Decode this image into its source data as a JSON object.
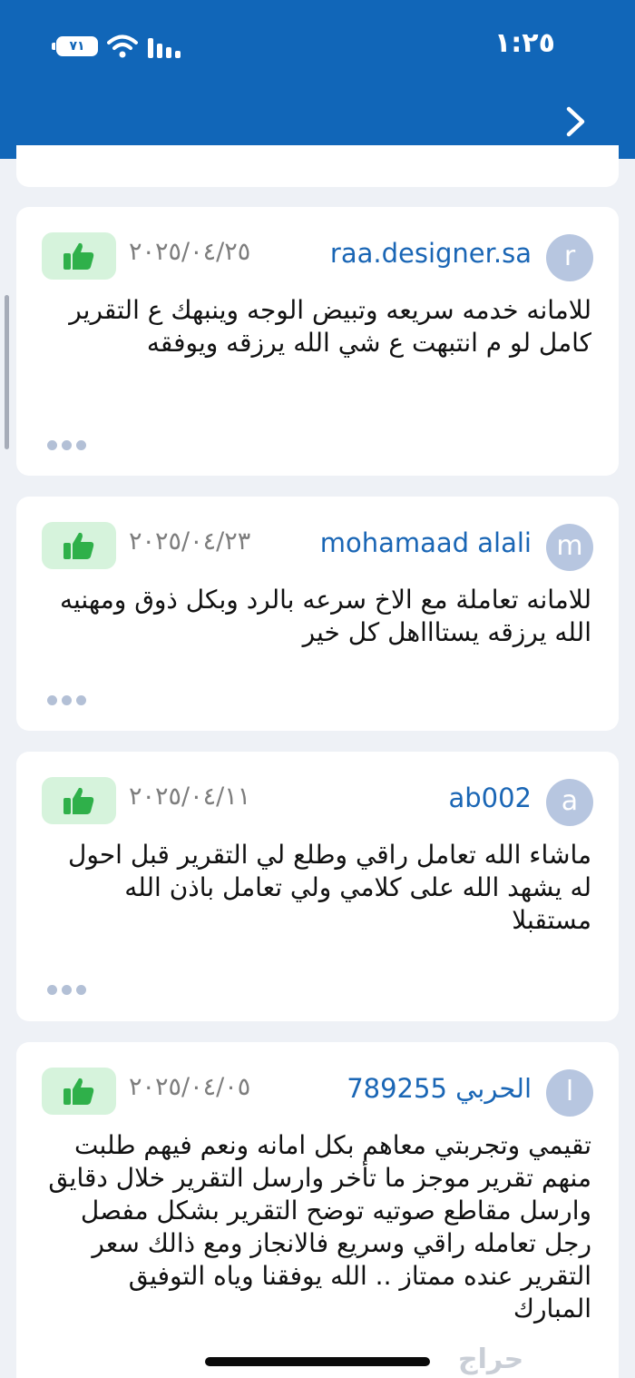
{
  "status_bar": {
    "time": "١:٢٥",
    "battery": "٧١",
    "background_color": "#1166b8"
  },
  "header": {
    "back_icon": "chevron-right-icon"
  },
  "reviews": [
    {
      "avatar_letter": "r",
      "username": "raa.designer.sa",
      "date": "٢٠٢٥/٠٤/٢٥",
      "like_icon": "thumbs-up-icon",
      "text": "للامانه خدمه سريعه وتبيض الوجه وينبهك ع التقرير كامل لو م انتبهت ع شي الله يرزقه ويوفقه",
      "more_icon": "more-dots-icon"
    },
    {
      "avatar_letter": "m",
      "username": "mohamaad alali",
      "date": "٢٠٢٥/٠٤/٢٣",
      "like_icon": "thumbs-up-icon",
      "text": "للامانه تعاملة مع الاخ سرعه بالرد وبكل ذوق ومهنيه الله يرزقه يستاااهل كل خير",
      "more_icon": "more-dots-icon"
    },
    {
      "avatar_letter": "a",
      "username": "ab002",
      "date": "٢٠٢٥/٠٤/١١",
      "like_icon": "thumbs-up-icon",
      "text": "ماشاء الله تعامل راقي وطلع لي التقرير قبل احول له يشهد الله على كلامي ولي تعامل باذن الله مستقبلا",
      "more_icon": "more-dots-icon"
    },
    {
      "avatar_letter": "ا",
      "username": "الحربي 789255",
      "date": "٢٠٢٥/٠٤/٠٥",
      "like_icon": "thumbs-up-icon",
      "text": "تقيمي وتجربتي معاهم بكل امانه ونعم فيهم طلبت منهم تقرير موجز ما تأخر وارسل التقرير خلال دقايق وارسل مقاطع صوتيه توضح التقرير بشكل مفصل رجل تعامله راقي وسريع فالانجاز ومع ذالك سعر التقرير عنده ممتاز .. الله يوفقنا وياه التوفيق المبارك",
      "more_icon": "more-dots-icon"
    }
  ],
  "watermark": "حراج",
  "colors": {
    "username": "#1a66b5",
    "like_badge": "#d6f3dc",
    "like_icon": "#2fb04a",
    "avatar": "#b7c6e0"
  }
}
